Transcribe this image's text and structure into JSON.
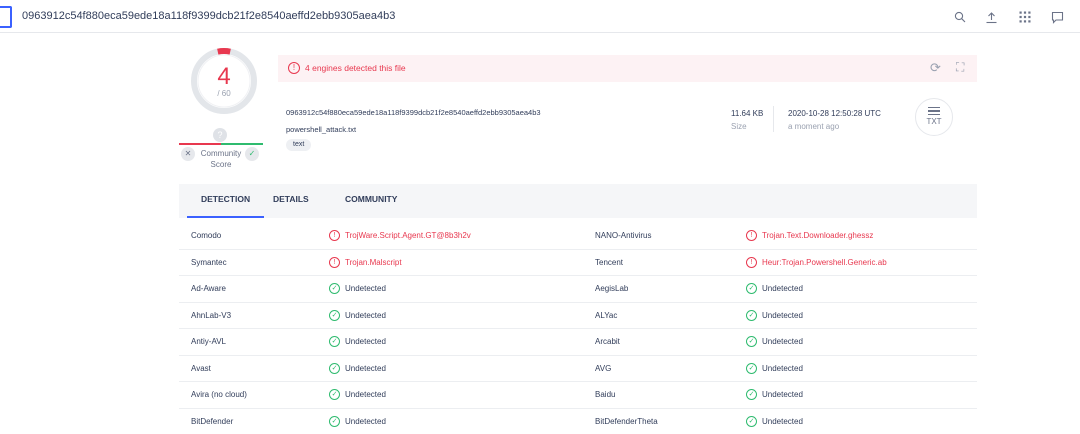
{
  "search": {
    "value": "0963912c54f880eca59ede18a118f9399dcb21f2e8540aeffd2ebb9305aea4b3"
  },
  "score": {
    "detections": "4",
    "total": "/ 60",
    "community_label": "Community Score",
    "question": "?"
  },
  "banner": {
    "text": "4 engines detected this file"
  },
  "file": {
    "hash": "0963912c54f880eca59ede18a118f9399dcb21f2e8540aeffd2ebb9305aea4b3",
    "name": "powershell_attack.txt",
    "tag": "text",
    "size_value": "11.64 KB",
    "size_label": "Size",
    "date_value": "2020-10-28 12:50:28 UTC",
    "date_label": "a moment ago",
    "type_badge": "TXT"
  },
  "tabs": [
    "DETECTION",
    "DETAILS",
    "COMMUNITY"
  ],
  "colors": {
    "malicious": "#e8384f",
    "clean": "#2fbb6f",
    "accent": "#3b61ff"
  },
  "detections": [
    {
      "left_engine": "Comodo",
      "left_result": "TrojWare.Script.Agent.GT@8b3h2v",
      "left_status": "malicious",
      "right_engine": "NANO-Antivirus",
      "right_result": "Trojan.Text.Downloader.ghessz",
      "right_status": "malicious"
    },
    {
      "left_engine": "Symantec",
      "left_result": "Trojan.Malscript",
      "left_status": "malicious",
      "right_engine": "Tencent",
      "right_result": "Heur:Trojan.Powershell.Generic.ab",
      "right_status": "malicious"
    },
    {
      "left_engine": "Ad-Aware",
      "left_result": "Undetected",
      "left_status": "clean",
      "right_engine": "AegisLab",
      "right_result": "Undetected",
      "right_status": "clean"
    },
    {
      "left_engine": "AhnLab-V3",
      "left_result": "Undetected",
      "left_status": "clean",
      "right_engine": "ALYac",
      "right_result": "Undetected",
      "right_status": "clean"
    },
    {
      "left_engine": "Antiy-AVL",
      "left_result": "Undetected",
      "left_status": "clean",
      "right_engine": "Arcabit",
      "right_result": "Undetected",
      "right_status": "clean"
    },
    {
      "left_engine": "Avast",
      "left_result": "Undetected",
      "left_status": "clean",
      "right_engine": "AVG",
      "right_result": "Undetected",
      "right_status": "clean"
    },
    {
      "left_engine": "Avira (no cloud)",
      "left_result": "Undetected",
      "left_status": "clean",
      "right_engine": "Baidu",
      "right_result": "Undetected",
      "right_status": "clean"
    },
    {
      "left_engine": "BitDefender",
      "left_result": "Undetected",
      "left_status": "clean",
      "right_engine": "BitDefenderTheta",
      "right_result": "Undetected",
      "right_status": "clean"
    }
  ]
}
